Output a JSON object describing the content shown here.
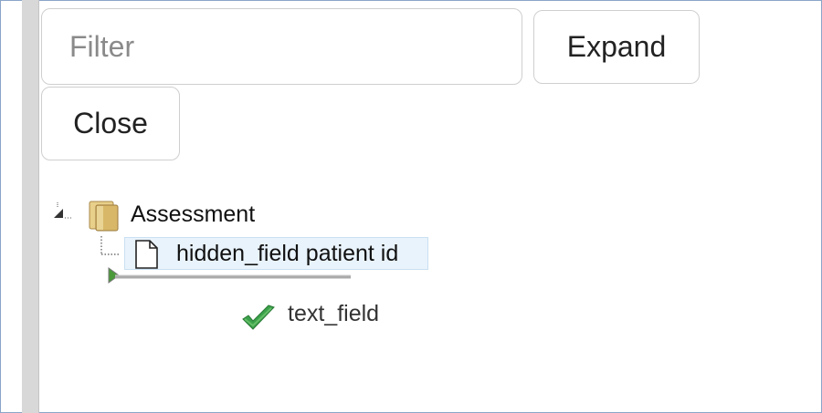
{
  "filter": {
    "placeholder": "Filter",
    "value": ""
  },
  "buttons": {
    "expand_label": "Expand",
    "close_label": "Close"
  },
  "tree": {
    "root": {
      "label": "Assessment",
      "icon": "folder-icon"
    },
    "child": {
      "label": "hidden_field patient id",
      "icon": "document-icon",
      "selected": true
    },
    "drag_item": {
      "label": "text_field",
      "icon": "checkmark-icon"
    }
  },
  "colors": {
    "selection_bg": "#e9f3fb",
    "check_green": "#3aa14a",
    "folder_tan": "#d8b868",
    "rail_gray": "#d8d8d8",
    "frame_blue": "#8aa4c8"
  }
}
